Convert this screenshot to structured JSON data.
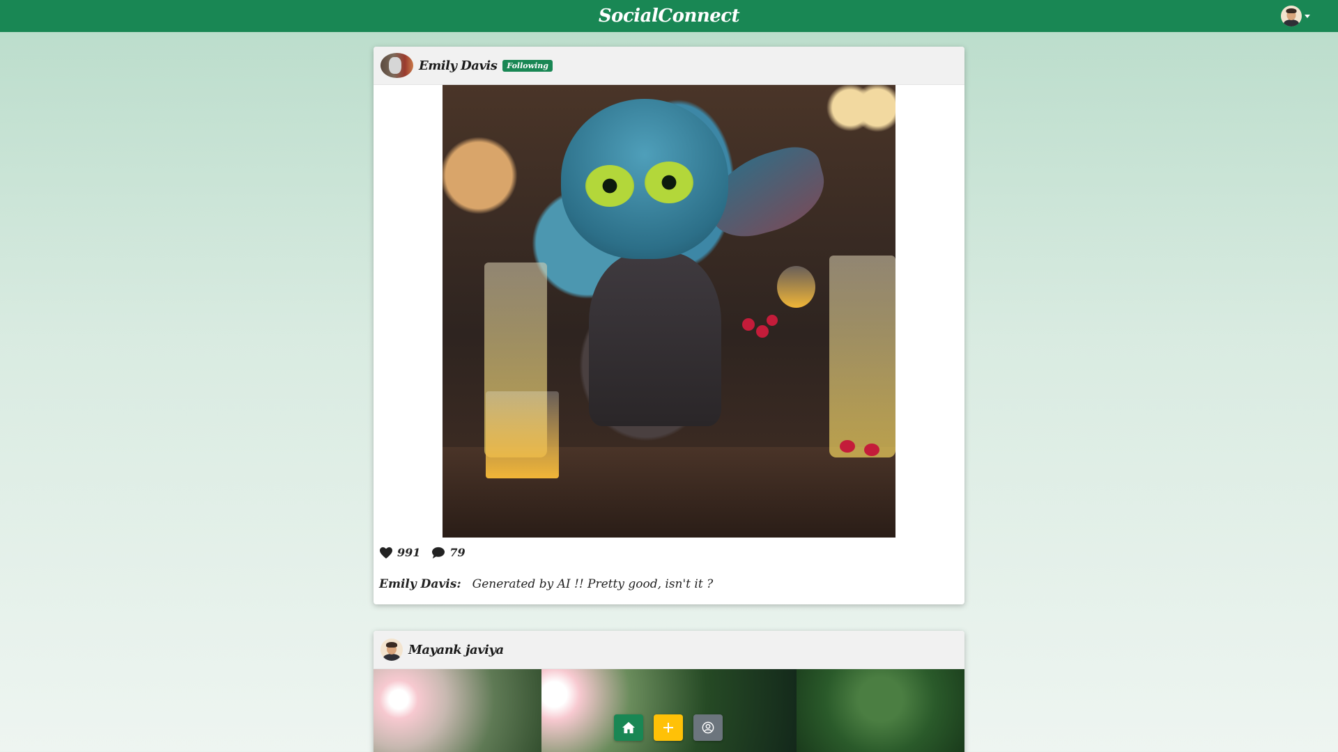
{
  "app": {
    "brand": "SocialConnect"
  },
  "header": {
    "user_avatar_icon": "user-avatar-icon",
    "menu_caret_icon": "caret-down-icon"
  },
  "posts": [
    {
      "author": "Emily Davis",
      "badge": "Following",
      "likes": "991",
      "comments": "79",
      "caption_author": "Emily Davis:",
      "caption_text": "Generated by AI !! Pretty good, isn't it ?"
    },
    {
      "author": "Mayank javiya"
    }
  ],
  "bottom_nav": {
    "home_icon": "home-icon",
    "add_icon": "plus-icon",
    "profile_icon": "profile-icon"
  },
  "colors": {
    "primary": "#198754",
    "accent": "#ffc107",
    "secondary": "#6c757d"
  }
}
